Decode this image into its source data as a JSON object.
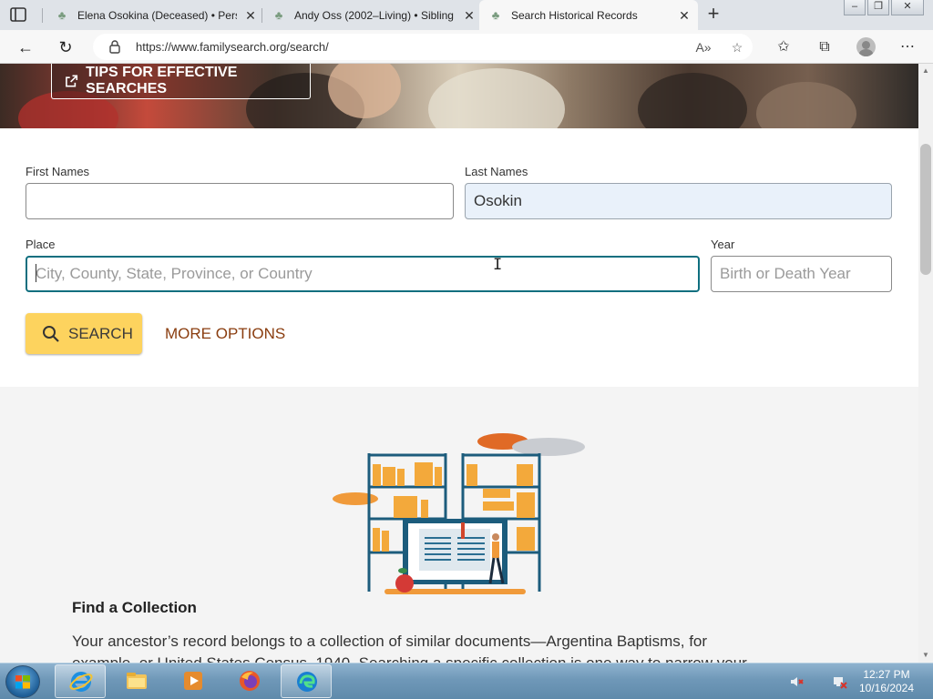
{
  "browser": {
    "tabs": [
      {
        "title": "Elena Osokina (Deceased) • Perso",
        "active": false
      },
      {
        "title": "Andy Oss (2002–Living) • Sibling",
        "active": false
      },
      {
        "title": "Search Historical Records",
        "active": true
      }
    ],
    "url": "https://www.familysearch.org/search/"
  },
  "hero": {
    "tips_label": "TIPS FOR EFFECTIVE SEARCHES"
  },
  "search_form": {
    "first_names": {
      "label": "First Names",
      "value": ""
    },
    "last_names": {
      "label": "Last Names",
      "value": "Osokin"
    },
    "place": {
      "label": "Place",
      "placeholder": "City, County, State, Province, or Country",
      "value": ""
    },
    "year": {
      "label": "Year",
      "placeholder": "Birth or Death Year",
      "value": ""
    },
    "search_label": "SEARCH",
    "more_options_label": "MORE OPTIONS"
  },
  "collection": {
    "title": "Find a Collection",
    "text": "Your ancestor’s record belongs to a collection of similar documents—Argentina Baptisms, for example, or United States Census, 1940. Searching a specific collection is one way to narrow your"
  },
  "taskbar": {
    "time": "12:27 PM",
    "date": "10/16/2024"
  },
  "colors": {
    "accent_teal": "#0f6f7f",
    "search_button": "#fdd35e",
    "more_options": "#8a3d0f"
  }
}
